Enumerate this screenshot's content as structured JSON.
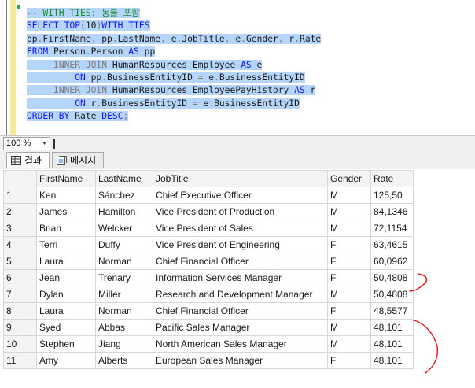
{
  "editor": {
    "lines": [
      [
        {
          "t": "-- WITH TIES: 동률 포함",
          "c": "cm"
        }
      ],
      [
        {
          "t": "SELECT",
          "c": "kw"
        },
        {
          "t": " ",
          "c": "tx"
        },
        {
          "t": "TOP",
          "c": "kw"
        },
        {
          "t": "(",
          "c": "gy"
        },
        {
          "t": "10",
          "c": "tx"
        },
        {
          "t": ")",
          "c": "gy"
        },
        {
          "t": "WITH",
          "c": "kw"
        },
        {
          "t": " ",
          "c": "tx"
        },
        {
          "t": "TIES",
          "c": "kw"
        }
      ],
      [
        {
          "t": "pp",
          "c": "tx"
        },
        {
          "t": ".",
          "c": "gy"
        },
        {
          "t": "FirstName",
          "c": "tx"
        },
        {
          "t": ",",
          "c": "gy"
        },
        {
          "t": " pp",
          "c": "tx"
        },
        {
          "t": ".",
          "c": "gy"
        },
        {
          "t": "LastName",
          "c": "tx"
        },
        {
          "t": ",",
          "c": "gy"
        },
        {
          "t": " e",
          "c": "tx"
        },
        {
          "t": ".",
          "c": "gy"
        },
        {
          "t": "JobTitle",
          "c": "tx"
        },
        {
          "t": ",",
          "c": "gy"
        },
        {
          "t": " e",
          "c": "tx"
        },
        {
          "t": ".",
          "c": "gy"
        },
        {
          "t": "Gender",
          "c": "tx"
        },
        {
          "t": ",",
          "c": "gy"
        },
        {
          "t": " r",
          "c": "tx"
        },
        {
          "t": ".",
          "c": "gy"
        },
        {
          "t": "Rate",
          "c": "tx"
        }
      ],
      [
        {
          "t": "FROM",
          "c": "kw"
        },
        {
          "t": " Person",
          "c": "tx"
        },
        {
          "t": ".",
          "c": "gy"
        },
        {
          "t": "Person ",
          "c": "tx"
        },
        {
          "t": "AS",
          "c": "kw"
        },
        {
          "t": " pp",
          "c": "tx"
        }
      ],
      [
        {
          "t": "     ",
          "c": "tx"
        },
        {
          "t": "INNER JOIN",
          "c": "gy"
        },
        {
          "t": " HumanResources",
          "c": "tx"
        },
        {
          "t": ".",
          "c": "gy"
        },
        {
          "t": "Employee ",
          "c": "tx"
        },
        {
          "t": "AS",
          "c": "kw"
        },
        {
          "t": " e",
          "c": "tx"
        }
      ],
      [
        {
          "t": "         ",
          "c": "tx"
        },
        {
          "t": "ON",
          "c": "kw"
        },
        {
          "t": " pp",
          "c": "tx"
        },
        {
          "t": ".",
          "c": "gy"
        },
        {
          "t": "BusinessEntityID ",
          "c": "tx"
        },
        {
          "t": "=",
          "c": "gy"
        },
        {
          "t": " e",
          "c": "tx"
        },
        {
          "t": ".",
          "c": "gy"
        },
        {
          "t": "BusinessEntityID",
          "c": "tx"
        }
      ],
      [
        {
          "t": "     ",
          "c": "tx"
        },
        {
          "t": "INNER JOIN",
          "c": "gy"
        },
        {
          "t": " HumanResources",
          "c": "tx"
        },
        {
          "t": ".",
          "c": "gy"
        },
        {
          "t": "EmployeePayHistory ",
          "c": "tx"
        },
        {
          "t": "AS",
          "c": "kw"
        },
        {
          "t": " r",
          "c": "tx"
        }
      ],
      [
        {
          "t": "         ",
          "c": "tx"
        },
        {
          "t": "ON",
          "c": "kw"
        },
        {
          "t": " r",
          "c": "tx"
        },
        {
          "t": ".",
          "c": "gy"
        },
        {
          "t": "BusinessEntityID ",
          "c": "tx"
        },
        {
          "t": "=",
          "c": "gy"
        },
        {
          "t": " e",
          "c": "tx"
        },
        {
          "t": ".",
          "c": "gy"
        },
        {
          "t": "BusinessEntityID",
          "c": "tx"
        }
      ],
      [
        {
          "t": "ORDER BY",
          "c": "kw"
        },
        {
          "t": " Rate ",
          "c": "tx"
        },
        {
          "t": "DESC",
          "c": "kw"
        },
        {
          "t": ";",
          "c": "gy"
        }
      ]
    ]
  },
  "zoom": {
    "value": "100 %"
  },
  "tabs": {
    "results": "결과",
    "messages": "메시지"
  },
  "grid": {
    "columns": [
      "FirstName",
      "LastName",
      "JobTitle",
      "Gender",
      "Rate"
    ],
    "rows": [
      [
        "1",
        "Ken",
        "Sánchez",
        "Chief Executive Officer",
        "M",
        "125,50"
      ],
      [
        "2",
        "James",
        "Hamilton",
        "Vice President of Production",
        "M",
        "84,1346"
      ],
      [
        "3",
        "Brian",
        "Welcker",
        "Vice President of Sales",
        "M",
        "72,1154"
      ],
      [
        "4",
        "Terri",
        "Duffy",
        "Vice President of Engineering",
        "F",
        "63,4615"
      ],
      [
        "5",
        "Laura",
        "Norman",
        "Chief Financial Officer",
        "F",
        "60,0962"
      ],
      [
        "6",
        "Jean",
        "Trenary",
        "Information Services Manager",
        "F",
        "50,4808"
      ],
      [
        "7",
        "Dylan",
        "Miller",
        "Research and Development Manager",
        "M",
        "50,4808"
      ],
      [
        "8",
        "Laura",
        "Norman",
        "Chief Financial Officer",
        "F",
        "48,5577"
      ],
      [
        "9",
        "Syed",
        "Abbas",
        "Pacific Sales Manager",
        "M",
        "48,101"
      ],
      [
        "10",
        "Stephen",
        "Jiang",
        "North American Sales Manager",
        "M",
        "48,101"
      ],
      [
        "11",
        "Amy",
        "Alberts",
        "European Sales Manager",
        "F",
        "48,101"
      ]
    ]
  },
  "colors": {
    "keyword": "#1515ff",
    "comment": "#1b8a2e",
    "selection": "#b5d5fb",
    "annotation": "#e0141c"
  }
}
